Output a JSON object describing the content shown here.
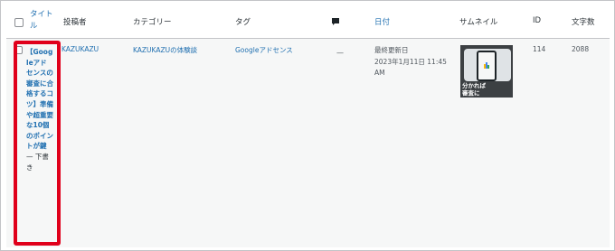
{
  "table": {
    "headers": {
      "title": "タイトル",
      "author": "投稿者",
      "category": "カテゴリー",
      "tag": "タグ",
      "comments_icon": "comment-bubble-icon",
      "date": "日付",
      "thumbnail": "サムネイル",
      "id": "ID",
      "word_count": "文字数"
    },
    "rows": [
      {
        "title": "【Googleアドセンスの審査に合格するコツ】準備や超重要な10個のポイントが鍵",
        "status": " — 下書き",
        "author": "KAZUKAZU",
        "category": "KAZUKAZUの体験談",
        "tag": "Googleアドセンス",
        "comments": "—",
        "date_label": "最終更新日",
        "date_value": "2023年1月11日 11:45 AM",
        "thumbnail_caption_1": "分かれば",
        "thumbnail_caption_2": "審査に",
        "id": "114",
        "word_count": "2088"
      }
    ]
  },
  "colors": {
    "link": "#2271b1",
    "highlight_border": "#e0001b"
  }
}
